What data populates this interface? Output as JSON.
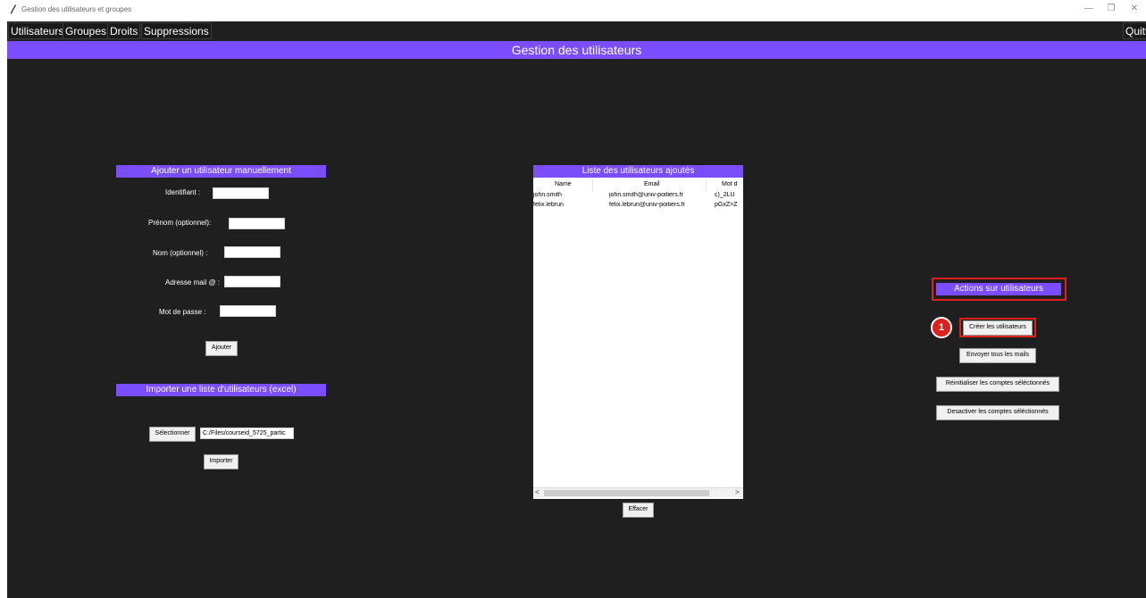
{
  "window": {
    "title": "Gestion des utilisateurs et groupes",
    "controls": [
      "—",
      "❐",
      "✕"
    ]
  },
  "menu": {
    "items": [
      "Utilisateurs",
      "Groupes",
      "Droits",
      "Suppressions"
    ],
    "quit": "Quitt"
  },
  "header": "Gestion des utilisateurs",
  "manual": {
    "title": "Ajouter un utilisateur manuellement",
    "fields": [
      {
        "label": "Identifiant :",
        "value": ""
      },
      {
        "label": "Prénom (optionnel):",
        "value": ""
      },
      {
        "label": "Nom (optionnel) :",
        "value": ""
      },
      {
        "label": "Adresse mail @ :",
        "value": ""
      },
      {
        "label": "Mot de passe :",
        "value": ""
      }
    ],
    "add_button": "Ajouter"
  },
  "import": {
    "title": "Importer une liste d'utilisateurs (excel)",
    "select_button": "Sélectionner",
    "path_value": "C:/Files/courseid_5725_partic",
    "import_button": "Importer"
  },
  "list": {
    "title": "Liste des utilisateurs ajoutés",
    "columns": [
      "Name",
      "Email",
      "Mot d"
    ],
    "rows": [
      [
        "john.smith",
        "john.smith@univ-poitiers.fr",
        "c)_2LU"
      ],
      [
        "felix.lebrun",
        "felix.lebrun@univ-poitiers.fr",
        "pGxZ>Z"
      ]
    ],
    "scroll_left": "<",
    "scroll_right": ">",
    "clear_button": "Effacer"
  },
  "actions": {
    "title": "Actions sur utilisateurs",
    "buttons": [
      "Créer les utilisateurs",
      "Envoyer tous les mails",
      "Réinitialiser les comptes séléctionnés",
      "Desactiver les comptes séléctionnés"
    ],
    "badge": "1"
  },
  "colors": {
    "accent": "#7a4dff",
    "background": "#1f1f1f",
    "highlight": "#e0201a"
  }
}
